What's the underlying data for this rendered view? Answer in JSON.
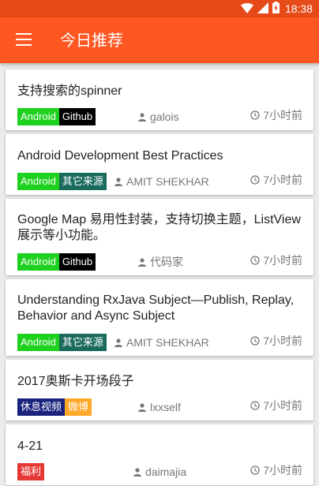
{
  "status_bar": {
    "time": "18:38"
  },
  "app_bar": {
    "title": "今日推荐"
  },
  "colors": {
    "status_bar": "#e64a19",
    "app_bar": "#ff5722",
    "tag_android": "#1fd11f",
    "tag_github": "#000000",
    "tag_other_source": "#1a6b5c",
    "tag_video": "#1a237e",
    "tag_weibo": "#ffa726",
    "tag_welfare": "#e53935"
  },
  "cards": [
    {
      "title": "支持搜索的spinner",
      "tags": [
        {
          "label": "Android",
          "color": "#1fd11f"
        },
        {
          "label": "Github",
          "color": "#000000"
        }
      ],
      "author": "galois",
      "time": "7小时前"
    },
    {
      "title": "Android Development Best Practices",
      "tags": [
        {
          "label": "Android",
          "color": "#1fd11f"
        },
        {
          "label": "其它来源",
          "color": "#1a6b5c"
        }
      ],
      "author": "AMIT SHEKHAR",
      "time": "7小时前"
    },
    {
      "title": "Google Map 易用性封装，支持切换主题，ListView 展示等小功能。",
      "tags": [
        {
          "label": "Android",
          "color": "#1fd11f"
        },
        {
          "label": "Github",
          "color": "#000000"
        }
      ],
      "author": "代码家",
      "time": "7小时前"
    },
    {
      "title": "Understanding RxJava Subject—Publish, Replay, Behavior and Async Subject",
      "tags": [
        {
          "label": "Android",
          "color": "#1fd11f"
        },
        {
          "label": "其它来源",
          "color": "#1a6b5c"
        }
      ],
      "author": "AMIT SHEKHAR",
      "time": "7小时前"
    },
    {
      "title": "2017奥斯卡开场段子",
      "tags": [
        {
          "label": "休息视频",
          "color": "#1a237e"
        },
        {
          "label": "微博",
          "color": "#ffa726"
        }
      ],
      "author": "lxxself",
      "time": "7小时前"
    },
    {
      "title": "4-21",
      "tags": [
        {
          "label": "福利",
          "color": "#e53935"
        }
      ],
      "author": "daimajia",
      "time": "7小时前"
    }
  ]
}
